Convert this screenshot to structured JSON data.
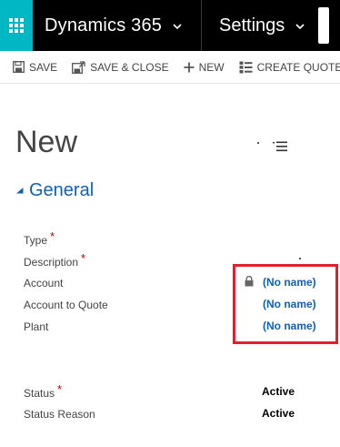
{
  "navbar": {
    "app_name": "Dynamics 365",
    "area_name": "Settings"
  },
  "commands": {
    "save": "SAVE",
    "save_close": "SAVE & CLOSE",
    "new": "NEW",
    "create_quote": "CREATE QUOTE"
  },
  "record": {
    "title": "New"
  },
  "section": {
    "general": "General"
  },
  "fields": {
    "type": {
      "label": "Type"
    },
    "description": {
      "label": "Description"
    },
    "account": {
      "label": "Account",
      "value": "(No name)"
    },
    "account_to_quote": {
      "label": "Account to Quote",
      "value": "(No name)"
    },
    "plant": {
      "label": "Plant",
      "value": "(No name)"
    },
    "status": {
      "label": "Status",
      "value": "Active"
    },
    "status_reason": {
      "label": "Status Reason",
      "value": "Active"
    }
  },
  "required_marker": "*",
  "colors": {
    "nav_bg": "#000000",
    "apps_accent": "#00b7c3",
    "link_blue": "#1160b7",
    "required_red": "#c00000",
    "highlight_red": "#e0202f"
  },
  "icons": {
    "apps": "waffle-grid-icon",
    "nav_chevron": "chevron-down-icon",
    "save": "floppy-disk-icon",
    "save_close": "save-close-icon",
    "new": "plus-icon",
    "create_quote": "list-icon",
    "form_selector": "form-list-icon",
    "section_toggle": "triangle-down-icon",
    "lock": "lock-icon"
  }
}
